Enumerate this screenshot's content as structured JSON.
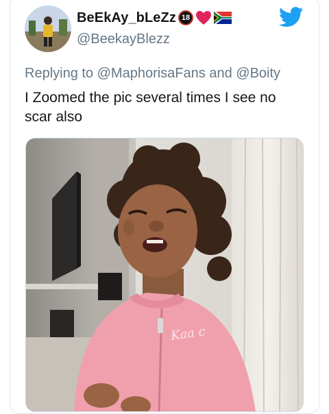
{
  "tweet": {
    "display_name": "BeEkAy_bLeZz",
    "badge_text": "18",
    "handle": "@BeekayBlezz",
    "replying_prefix": "Replying to",
    "reply_to_1": "@MaphorisaFans",
    "reply_joiner": "and",
    "reply_to_2": "@Boity",
    "text": "I Zoomed the pic several times I see no scar also",
    "hoodie_text": "Kaa c"
  },
  "icons": {
    "brand": "twitter-bird-icon",
    "emoji": [
      "heart-emoji",
      "south-africa-flag-emoji"
    ]
  },
  "colors": {
    "twitter_blue": "#1da1f2",
    "secondary_text": "#657786",
    "primary_text": "#14171a",
    "hoodie_pink": "#f0a0ad"
  }
}
